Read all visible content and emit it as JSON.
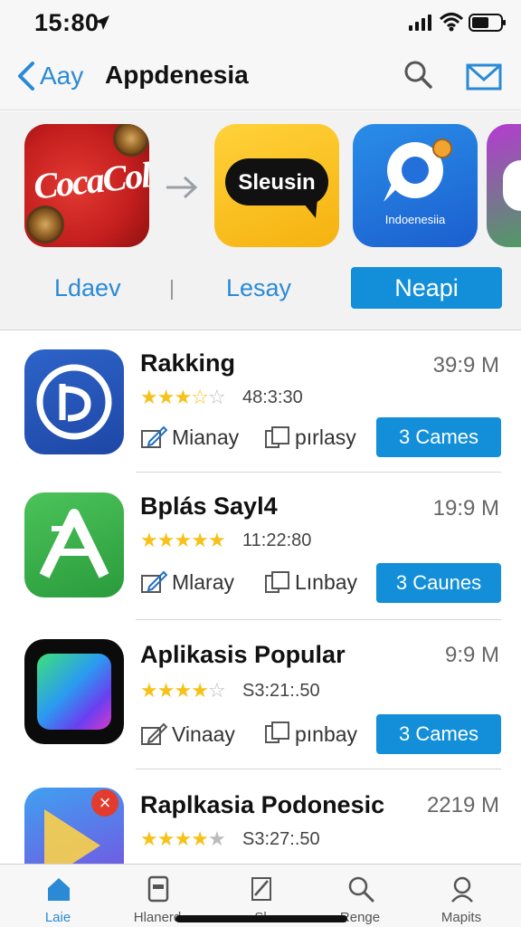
{
  "status_bar": {
    "time": "15:80"
  },
  "nav": {
    "back_label": "Aay",
    "title": "Appdenesia"
  },
  "featured": {
    "tiles": [
      {
        "brand_text": "CocaCola"
      },
      {
        "brand_text": "Sleusin"
      },
      {
        "brand_text": "Indoenesiia"
      }
    ],
    "labels": [
      "Ldaev",
      "Lesay"
    ],
    "button_label": "Neapi"
  },
  "apps": [
    {
      "name": "Rakking",
      "size": "39:9 M",
      "rating": 3.5,
      "time": "48:3:30",
      "action1": "Mianay",
      "action2": "pırlasy",
      "button": "3 Cames"
    },
    {
      "name": "Bplás Sayl4",
      "size": "19:9 M",
      "rating": 4.5,
      "time": "11:22:80",
      "action1": "Mlaray",
      "action2": "Lınbay",
      "button": "3 Caunes"
    },
    {
      "name": "Aplikasis Popular",
      "size": "9:9 M",
      "rating": 3.5,
      "time": "S3:21:.50",
      "action1": "Vinaay",
      "action2": "pınbay",
      "button": "3 Cames"
    },
    {
      "name": "Raplkasia Podonesic",
      "size": "2219 M",
      "rating": 3.5,
      "time": "S3:27:.50"
    }
  ],
  "tabs": [
    {
      "label": "Laie",
      "icon": "home-icon",
      "active": true
    },
    {
      "label": "Hlanerd",
      "icon": "document-icon",
      "active": false
    },
    {
      "label": "Sl",
      "icon": "pen-icon",
      "active": false
    },
    {
      "label": "Renge",
      "icon": "search-icon",
      "active": false
    },
    {
      "label": "Mapits",
      "icon": "profile-search-icon",
      "active": false
    }
  ],
  "colors": {
    "accent": "#2a8ad6",
    "button": "#138fd9",
    "star": "#f6c21a"
  }
}
